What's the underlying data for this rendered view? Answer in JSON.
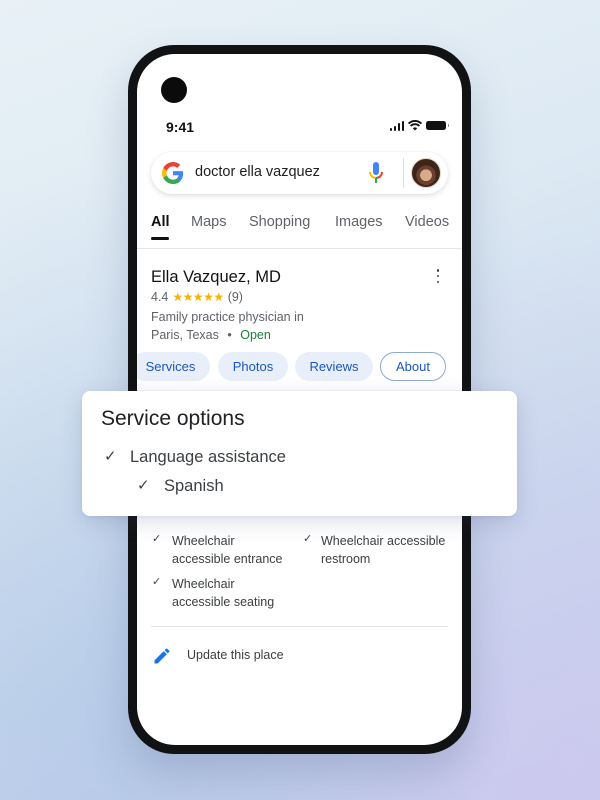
{
  "status_bar": {
    "time": "9:41"
  },
  "search": {
    "query": "doctor ella vazquez"
  },
  "tabs": [
    {
      "label": "All",
      "active": true
    },
    {
      "label": "Maps",
      "active": false
    },
    {
      "label": "Shopping",
      "active": false
    },
    {
      "label": "Images",
      "active": false
    },
    {
      "label": "Videos",
      "active": false
    }
  ],
  "place": {
    "name": "Ella Vazquez, MD",
    "rating": "4.4",
    "stars": "★★★★★",
    "review_count": "(9)",
    "category_line": "Family practice physician in",
    "location": "Paris, Texas",
    "separator": "•",
    "status": "Open"
  },
  "chips": [
    {
      "label": "Services"
    },
    {
      "label": "Photos"
    },
    {
      "label": "Reviews"
    },
    {
      "label": "About",
      "selected": true
    }
  ],
  "service_options": {
    "title": "Service options",
    "items": [
      {
        "label": "Language assistance"
      },
      {
        "label": "Spanish"
      }
    ]
  },
  "accessibility": [
    {
      "line1": "Wheelchair",
      "line2": "accessible entrance"
    },
    {
      "line1": "Wheelchair accessible",
      "line2": "restroom"
    },
    {
      "line1": "Wheelchair",
      "line2": "accessible seating"
    }
  ],
  "check_glyph": "✓",
  "update_link": "Update this place",
  "colors": {
    "accent_blue": "#1a56c2",
    "open_green": "#188038",
    "star_yellow": "#f5b400"
  }
}
